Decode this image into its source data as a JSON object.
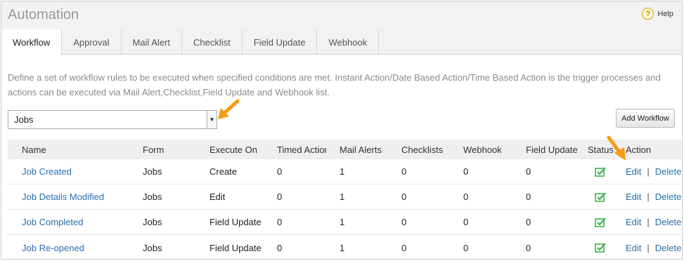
{
  "header": {
    "title": "Automation",
    "help_label": "Help",
    "help_icon": "?"
  },
  "tabs": [
    {
      "label": "Workflow",
      "active": true
    },
    {
      "label": "Approval",
      "active": false
    },
    {
      "label": "Mail Alert",
      "active": false
    },
    {
      "label": "Checklist",
      "active": false
    },
    {
      "label": "Field Update",
      "active": false
    },
    {
      "label": "Webhook",
      "active": false
    }
  ],
  "description": "Define a set of workflow rules to be executed when specified conditions are met. Instant Action/Date Based Action/Time Based Action is the trigger processes and actions can be executed via Mail Alert,Checklist,Field Update and Webhook list.",
  "module_select": {
    "value": "Jobs"
  },
  "add_workflow_label": "Add Workflow",
  "table": {
    "columns": [
      "Name",
      "Form",
      "Execute On",
      "Timed Action",
      "Mail Alerts",
      "Checklists",
      "Webhook",
      "Field Update",
      "Status",
      "Action"
    ],
    "rows": [
      {
        "name": "Job Created",
        "form": "Jobs",
        "execute_on": "Create",
        "timed_action": "0",
        "mail_alerts": "1",
        "checklists": "0",
        "webhook": "0",
        "field_update": "0"
      },
      {
        "name": "Job Details Modified",
        "form": "Jobs",
        "execute_on": "Edit",
        "timed_action": "0",
        "mail_alerts": "1",
        "checklists": "0",
        "webhook": "0",
        "field_update": "0"
      },
      {
        "name": "Job Completed",
        "form": "Jobs",
        "execute_on": "Field Update",
        "timed_action": "0",
        "mail_alerts": "1",
        "checklists": "0",
        "webhook": "0",
        "field_update": "0"
      },
      {
        "name": "Job Re-opened",
        "form": "Jobs",
        "execute_on": "Field Update",
        "timed_action": "0",
        "mail_alerts": "1",
        "checklists": "0",
        "webhook": "0",
        "field_update": "0"
      }
    ],
    "edit_label": "Edit",
    "delete_label": "Delete",
    "separator": "|"
  },
  "colors": {
    "link": "#2a6ead",
    "status_enabled": "#3bb54a",
    "annotation_arrow": "#f39c12"
  }
}
